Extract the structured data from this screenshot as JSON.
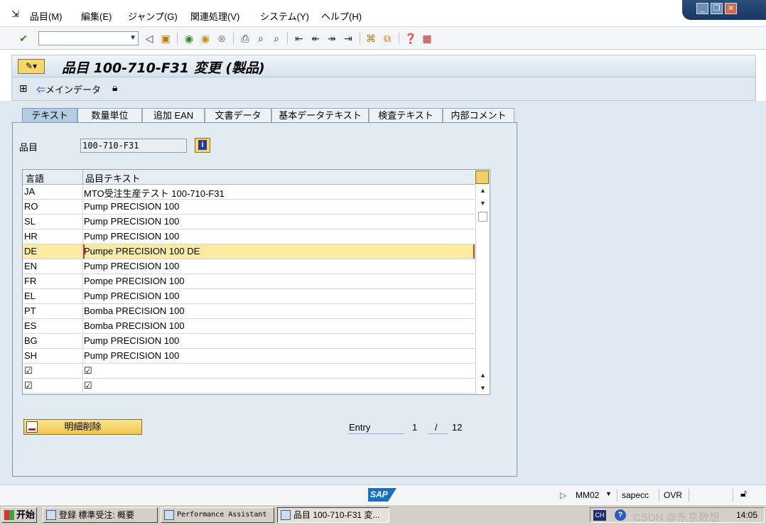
{
  "menu": {
    "items": [
      "品目(M)",
      "編集(E)",
      "ジャンプ(G)",
      "関連処理(V)",
      "システム(Y)",
      "ヘルプ(H)"
    ]
  },
  "window_controls": {
    "minimize": "_",
    "restore": "❐",
    "close": "✕"
  },
  "header": {
    "title": "品目 100-710-F31 変更 (製品)"
  },
  "app_toolbar": {
    "main_data_label": "メインデータ"
  },
  "tabs": [
    {
      "label": "テキスト",
      "active": true
    },
    {
      "label": "数量単位",
      "active": false
    },
    {
      "label": "追加 EAN",
      "active": false
    },
    {
      "label": "文書データ",
      "active": false
    },
    {
      "label": "基本データテキスト",
      "active": false
    },
    {
      "label": "検査テキスト",
      "active": false
    },
    {
      "label": "内部コメント",
      "active": false
    }
  ],
  "material": {
    "label": "品目",
    "value": "100-710-F31"
  },
  "table": {
    "headers": {
      "language": "言語",
      "text": "品目テキスト"
    },
    "rows": [
      {
        "lang": "JA",
        "text": "MTO受注生産テスト 100-710-F31"
      },
      {
        "lang": "RO",
        "text": "Pump PRECISION 100"
      },
      {
        "lang": "SL",
        "text": "Pump PRECISION 100"
      },
      {
        "lang": "HR",
        "text": "Pump PRECISION 100"
      },
      {
        "lang": "DE",
        "text": "Pumpe PRECISION 100 DE",
        "selected": true
      },
      {
        "lang": "EN",
        "text": "Pump PRECISION 100"
      },
      {
        "lang": "FR",
        "text": "Pompe PRECISION 100"
      },
      {
        "lang": "EL",
        "text": "Pump PRECISION 100"
      },
      {
        "lang": "PT",
        "text": "Bomba PRECISION 100"
      },
      {
        "lang": "ES",
        "text": "Bomba PRECISION 100"
      },
      {
        "lang": "BG",
        "text": "Pump PRECISION 100"
      },
      {
        "lang": "SH",
        "text": "Pump PRECISION 100"
      },
      {
        "lang": "☑",
        "text": "☑"
      },
      {
        "lang": "☑",
        "text": "☑"
      }
    ]
  },
  "buttons": {
    "delete_detail": "明細削除"
  },
  "entry": {
    "label": "Entry",
    "current": "1",
    "slash": "/",
    "total": "12"
  },
  "status": {
    "logo": "SAP",
    "transaction": "MM02",
    "server": "sapecc",
    "mode": "OVR"
  },
  "taskbar": {
    "start": "开始",
    "tasks": [
      "登録 標準受注: 概要",
      "Performance Assistant",
      "品目 100-710-F31 変..."
    ],
    "ime": "CH",
    "help": "?",
    "watermark": "CSDN @东京数想",
    "clock": "14:05"
  },
  "colors": {
    "sap_blue": "#1770c8",
    "selected_row": "#ffeaa3",
    "button_yellow": "#f8d76a",
    "panel_bg": "#dfe8f0"
  }
}
